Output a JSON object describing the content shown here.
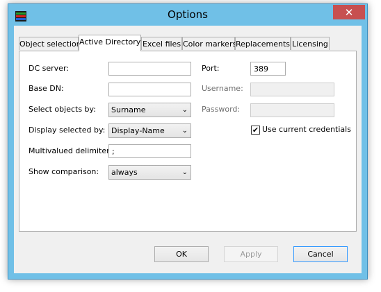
{
  "window": {
    "title": "Options",
    "close_glyph": "✕",
    "app_icon": "stacked-color-bars-icon",
    "app_icon_colors": [
      "#2a9a2a",
      "#d92020",
      "#2060d0"
    ]
  },
  "tabs": [
    {
      "label": "Object selection",
      "active": false
    },
    {
      "label": "Active Directory",
      "active": true
    },
    {
      "label": "Excel files",
      "active": false
    },
    {
      "label": "Color markers",
      "active": false
    },
    {
      "label": "Replacements",
      "active": false
    },
    {
      "label": "Licensing",
      "active": false
    }
  ],
  "form": {
    "dc_server": {
      "label": "DC server:",
      "value": ""
    },
    "base_dn": {
      "label": "Base DN:",
      "value": ""
    },
    "select_objects_by": {
      "label": "Select objects by:",
      "value": "Surname"
    },
    "display_selected_by": {
      "label": "Display selected by:",
      "value": "Display-Name"
    },
    "multivalued_delimiter": {
      "label": "Multivalued delimiter:",
      "value": ";"
    },
    "show_comparison": {
      "label": "Show comparison:",
      "value": "always"
    },
    "port": {
      "label": "Port:",
      "value": "389"
    },
    "username": {
      "label": "Username:",
      "value": ""
    },
    "password": {
      "label": "Password:",
      "value": ""
    },
    "use_current_credentials": {
      "label": "Use current credentials",
      "checked": true,
      "check_glyph": "✔"
    }
  },
  "buttons": {
    "ok": "OK",
    "apply": "Apply",
    "cancel": "Cancel"
  },
  "colors": {
    "title_bar": "#70c0e7",
    "close_button": "#c75050"
  }
}
